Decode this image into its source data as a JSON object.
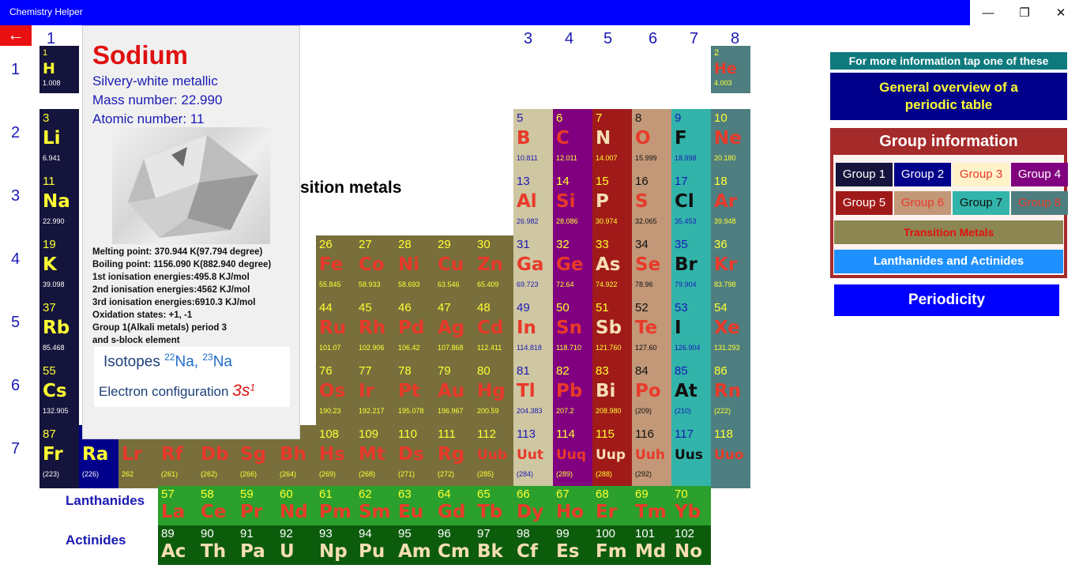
{
  "app": {
    "title": "Chemistry Helper"
  },
  "window": {
    "minimize": "—",
    "maximize": "❐",
    "close": "✕"
  },
  "back_button": {
    "glyph": "←"
  },
  "group_numbers": [
    "1",
    "3",
    "4",
    "5",
    "6",
    "7",
    "8"
  ],
  "period_numbers": [
    "1",
    "2",
    "3",
    "4",
    "5",
    "6",
    "7"
  ],
  "section_label": "sition metals",
  "table_rows": [
    [
      {
        "n": "1",
        "s": "H",
        "m": "1.008",
        "g": "1"
      },
      {
        "n": "2",
        "s": "He",
        "m": "4.003",
        "g": "8"
      }
    ],
    [
      {
        "n": "3",
        "s": "Li",
        "m": "6.941",
        "g": "1"
      },
      {
        "n": "5",
        "s": "B",
        "m": "10.811",
        "g": "3"
      },
      {
        "n": "6",
        "s": "C",
        "m": "12.011",
        "g": "4"
      },
      {
        "n": "7",
        "s": "N",
        "m": "14.007",
        "g": "5"
      },
      {
        "n": "8",
        "s": "O",
        "m": "15.999",
        "g": "6"
      },
      {
        "n": "9",
        "s": "F",
        "m": "18.998",
        "g": "7"
      },
      {
        "n": "10",
        "s": "Ne",
        "m": "20.180",
        "g": "8"
      }
    ],
    [
      {
        "n": "11",
        "s": "Na",
        "m": "22.990",
        "g": "1"
      },
      {
        "n": "13",
        "s": "Al",
        "m": "26.982",
        "g": "3"
      },
      {
        "n": "14",
        "s": "Si",
        "m": "28.086",
        "g": "4"
      },
      {
        "n": "15",
        "s": "P",
        "m": "30.974",
        "g": "5"
      },
      {
        "n": "16",
        "s": "S",
        "m": "32.065",
        "g": "6"
      },
      {
        "n": "17",
        "s": "Cl",
        "m": "35.453",
        "g": "7"
      },
      {
        "n": "18",
        "s": "Ar",
        "m": "39.948",
        "g": "8"
      }
    ],
    [
      {
        "n": "19",
        "s": "K",
        "m": "39.098",
        "g": "1"
      },
      {
        "n": "26",
        "s": "Fe",
        "m": "55.845",
        "g": "T"
      },
      {
        "n": "27",
        "s": "Co",
        "m": "58.933",
        "g": "T"
      },
      {
        "n": "28",
        "s": "Ni",
        "m": "58.693",
        "g": "T"
      },
      {
        "n": "29",
        "s": "Cu",
        "m": "63.546",
        "g": "T"
      },
      {
        "n": "30",
        "s": "Zn",
        "m": "65.409",
        "g": "T"
      },
      {
        "n": "31",
        "s": "Ga",
        "m": "69.723",
        "g": "3"
      },
      {
        "n": "32",
        "s": "Ge",
        "m": "72.64",
        "g": "4"
      },
      {
        "n": "33",
        "s": "As",
        "m": "74.922",
        "g": "5"
      },
      {
        "n": "34",
        "s": "Se",
        "m": "78.96",
        "g": "6"
      },
      {
        "n": "35",
        "s": "Br",
        "m": "79.904",
        "g": "7"
      },
      {
        "n": "36",
        "s": "Kr",
        "m": "83.798",
        "g": "8"
      }
    ],
    [
      {
        "n": "37",
        "s": "Rb",
        "m": "85.468",
        "g": "1"
      },
      {
        "n": "44",
        "s": "Ru",
        "m": "101.07",
        "g": "T"
      },
      {
        "n": "45",
        "s": "Rh",
        "m": "102.906",
        "g": "T"
      },
      {
        "n": "46",
        "s": "Pd",
        "m": "106.42",
        "g": "T"
      },
      {
        "n": "47",
        "s": "Ag",
        "m": "107.868",
        "g": "T"
      },
      {
        "n": "48",
        "s": "Cd",
        "m": "112.411",
        "g": "T"
      },
      {
        "n": "49",
        "s": "In",
        "m": "114.818",
        "g": "3"
      },
      {
        "n": "50",
        "s": "Sn",
        "m": "118.710",
        "g": "4"
      },
      {
        "n": "51",
        "s": "Sb",
        "m": "121.760",
        "g": "5"
      },
      {
        "n": "52",
        "s": "Te",
        "m": "127.60",
        "g": "6"
      },
      {
        "n": "53",
        "s": "I",
        "m": "126.904",
        "g": "7"
      },
      {
        "n": "54",
        "s": "Xe",
        "m": "131.293",
        "g": "8"
      }
    ],
    [
      {
        "n": "55",
        "s": "Cs",
        "m": "132.905",
        "g": "1"
      },
      {
        "n": "76",
        "s": "Os",
        "m": "190.23",
        "g": "T"
      },
      {
        "n": "77",
        "s": "Ir",
        "m": "192.217",
        "g": "T"
      },
      {
        "n": "78",
        "s": "Pt",
        "m": "195.078",
        "g": "T"
      },
      {
        "n": "79",
        "s": "Au",
        "m": "196.967",
        "g": "T"
      },
      {
        "n": "80",
        "s": "Hg",
        "m": "200.59",
        "g": "T"
      },
      {
        "n": "81",
        "s": "Tl",
        "m": "204.383",
        "g": "3"
      },
      {
        "n": "82",
        "s": "Pb",
        "m": "207.2",
        "g": "4"
      },
      {
        "n": "83",
        "s": "Bi",
        "m": "208.980",
        "g": "5"
      },
      {
        "n": "84",
        "s": "Po",
        "m": "(209)",
        "g": "6"
      },
      {
        "n": "85",
        "s": "At",
        "m": "(210)",
        "g": "7"
      },
      {
        "n": "86",
        "s": "Rn",
        "m": "(222)",
        "g": "8"
      }
    ],
    [
      {
        "n": "87",
        "s": "Fr",
        "m": "(223)",
        "g": "1"
      },
      {
        "n": "88",
        "s": "Ra",
        "m": "(226)",
        "g": "2"
      },
      {
        "n": "",
        "s": "Lr",
        "m": "262",
        "g": "T"
      },
      {
        "n": "",
        "s": "Rf",
        "m": "(261)",
        "g": "T"
      },
      {
        "n": "",
        "s": "Db",
        "m": "(262)",
        "g": "T"
      },
      {
        "n": "",
        "s": "Sg",
        "m": "(266)",
        "g": "T"
      },
      {
        "n": "",
        "s": "Bh",
        "m": "(264)",
        "g": "T"
      },
      {
        "n": "108",
        "s": "Hs",
        "m": "(269)",
        "g": "T"
      },
      {
        "n": "109",
        "s": "Mt",
        "m": "(268)",
        "g": "T"
      },
      {
        "n": "110",
        "s": "Ds",
        "m": "(271)",
        "g": "T"
      },
      {
        "n": "111",
        "s": "Rg",
        "m": "(272)",
        "g": "T"
      },
      {
        "n": "112",
        "s": "Uub",
        "m": "(285)",
        "g": "T"
      },
      {
        "n": "113",
        "s": "Uut",
        "m": "(284)",
        "g": "3"
      },
      {
        "n": "114",
        "s": "Uuq",
        "m": "(289)",
        "g": "4"
      },
      {
        "n": "115",
        "s": "Uup",
        "m": "(288)",
        "g": "5"
      },
      {
        "n": "116",
        "s": "Uuh",
        "m": "(292)",
        "g": "6"
      },
      {
        "n": "117",
        "s": "Uus",
        "m": "",
        "g": "7"
      },
      {
        "n": "118",
        "s": "Uuo",
        "m": "",
        "g": "8"
      }
    ]
  ],
  "series_labels": {
    "lanthanides": "Lanthanides",
    "actinides": "Actinides"
  },
  "lanthanides": [
    {
      "n": "57",
      "s": "La"
    },
    {
      "n": "58",
      "s": "Ce"
    },
    {
      "n": "59",
      "s": "Pr"
    },
    {
      "n": "60",
      "s": "Nd"
    },
    {
      "n": "61",
      "s": "Pm"
    },
    {
      "n": "62",
      "s": "Sm"
    },
    {
      "n": "63",
      "s": "Eu"
    },
    {
      "n": "64",
      "s": "Gd"
    },
    {
      "n": "65",
      "s": "Tb"
    },
    {
      "n": "66",
      "s": "Dy"
    },
    {
      "n": "67",
      "s": "Ho"
    },
    {
      "n": "68",
      "s": "Er"
    },
    {
      "n": "69",
      "s": "Tm"
    },
    {
      "n": "70",
      "s": "Yb"
    }
  ],
  "actinides": [
    {
      "n": "89",
      "s": "Ac"
    },
    {
      "n": "90",
      "s": "Th"
    },
    {
      "n": "91",
      "s": "Pa"
    },
    {
      "n": "92",
      "s": "U"
    },
    {
      "n": "93",
      "s": "Np"
    },
    {
      "n": "94",
      "s": "Pu"
    },
    {
      "n": "95",
      "s": "Am"
    },
    {
      "n": "96",
      "s": "Cm"
    },
    {
      "n": "97",
      "s": "Bk"
    },
    {
      "n": "98",
      "s": "Cf"
    },
    {
      "n": "99",
      "s": "Es"
    },
    {
      "n": "100",
      "s": "Fm"
    },
    {
      "n": "101",
      "s": "Md"
    },
    {
      "n": "102",
      "s": "No"
    }
  ],
  "popup": {
    "name": "Sodium",
    "appearance": "Silvery-white metallic",
    "mass": "Mass number: 22.990",
    "atomic": "Atomic number: 11",
    "props": [
      "Melting point: 370.944 K(97.794 degree)",
      "Boiling point: 1156.090 K(882.940 degree)",
      "1st ionisation energies:495.8 KJ/mol",
      "2nd ionisation energies:4562 KJ/mol",
      "3rd ionisation energies:6910.3 KJ/mol",
      "Oxidation states: +1, -1",
      "Group 1(Alkali metals) period 3",
      "and s-block element"
    ],
    "isotopes_label": "Isotopes",
    "iso1_sup": "22",
    "iso1_sym": "Na,",
    "iso2_sup": "23",
    "iso2_sym": "Na",
    "econf_label": "Electron configuration",
    "econf_value": "3s",
    "econf_sup": "1"
  },
  "right_panel": {
    "info_banner": "For more information tap one of these",
    "overview_button": "General overview of a periodic table",
    "group_info_title": "Group information",
    "groups": [
      "Group 1",
      "Group 2",
      "Group 3",
      "Group 4",
      "Group 5",
      "Group 6",
      "Group 7",
      "Group 8"
    ],
    "transition": "Transition Metals",
    "lanth_act": "Lanthanides and Actinides",
    "periodicity": "Periodicity"
  },
  "colors": {
    "titlebar": "#0000ff",
    "g1": "#14143c",
    "g2": "#00008b",
    "g3": "#cfc6a2",
    "g4": "#800080",
    "g5": "#a11a1a",
    "g6": "#c29878",
    "g7": "#32b4aa",
    "g8": "#4e7e80",
    "transition": "#786f3c",
    "lanthanide": "#2ca02c",
    "actinide": "#0c5c0c",
    "symbol_yellow": "#ffff33",
    "symbol_red": "#e83a2a",
    "group_panel_border": "#a52a2a"
  }
}
